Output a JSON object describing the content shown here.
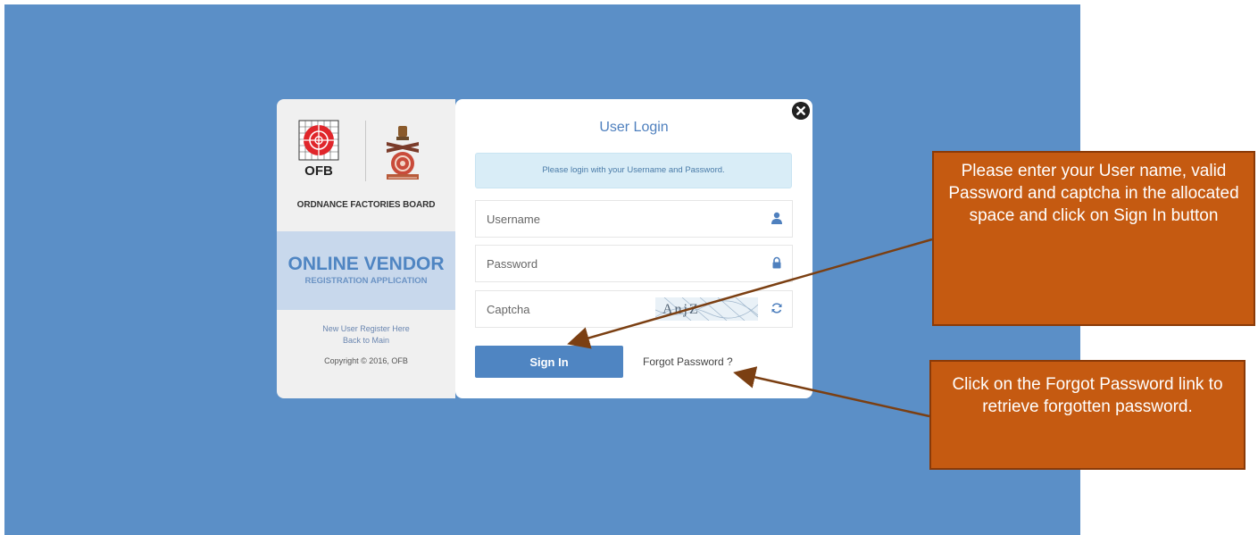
{
  "left_panel": {
    "logo_text": "OFB",
    "board_name": "ORDNANCE FACTORIES BOARD",
    "vendor_title": "ONLINE VENDOR",
    "vendor_subtitle": "REGISTRATION APPLICATION",
    "register_link": "New User Register Here",
    "back_link": "Back to Main",
    "copyright": "Copyright © 2016, OFB"
  },
  "login": {
    "title": "User Login",
    "info_message": "Please login with your Username and Password.",
    "username_placeholder": "Username",
    "password_placeholder": "Password",
    "captcha_placeholder": "Captcha",
    "captcha_text": "AnjZ",
    "signin_label": "Sign In",
    "forgot_label": "Forgot Password ?"
  },
  "annotations": {
    "callout_signin": "Please enter your User name, valid Password and captcha in the allocated space and click on Sign In button",
    "callout_forgot": "Click on the Forgot Password link to retrieve forgotten password."
  },
  "colors": {
    "backdrop": "#5b8fc7",
    "accent": "#4f85c2",
    "callout_fill": "#c55a11",
    "arrow": "#7b3f12"
  },
  "icons": [
    "close-icon",
    "user-icon",
    "lock-icon",
    "refresh-icon",
    "ofb-logo",
    "national-emblem"
  ]
}
